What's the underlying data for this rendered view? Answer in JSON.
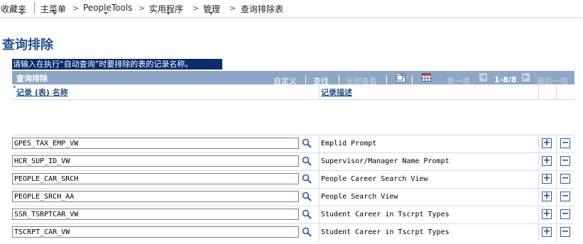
{
  "nav": {
    "favorites": "收藏夹",
    "main_menu": "主菜单",
    "peopletools": "PeopleTools",
    "utilities": "实用程序",
    "admin": "管理",
    "current": "查询排除表"
  },
  "page_title": "查询排除",
  "instruction": "请输入在执行“自动查询”时要排除的表的记录名称。",
  "grid": {
    "title": "查询排除",
    "customize": "自定义",
    "find": "查找",
    "view_all": "全部查看",
    "first": "第一项",
    "range": "1-8/8",
    "last": "最后一项",
    "col_record": "记录 (表) 名称",
    "col_desc": "记录描述",
    "rows": [
      {
        "record": "GPES_TAX_EMP_VW",
        "desc": "Emplid Prompt"
      },
      {
        "record": "HCR_SUP_ID_VW",
        "desc": "Supervisor/Manager Name Prompt"
      },
      {
        "record": "PEOPLE_CAR_SRCH",
        "desc": "People Career Search View"
      },
      {
        "record": "PEOPLE_SRCH_AA",
        "desc": "People Search View"
      },
      {
        "record": "SSR_TSRPTCAR_VW",
        "desc": "Student Career in Tscrpt Types"
      },
      {
        "record": "TSCRPT_CAR_VW",
        "desc": "Student Career in Tscrpt Types"
      }
    ]
  },
  "icons": {
    "lookup": "magnifier-icon",
    "add": "plus-icon",
    "delete": "minus-icon"
  },
  "colors": {
    "grid_header": "#8ea6c7",
    "title": "#24508d",
    "instruction_bg": "#0b2c6f"
  }
}
